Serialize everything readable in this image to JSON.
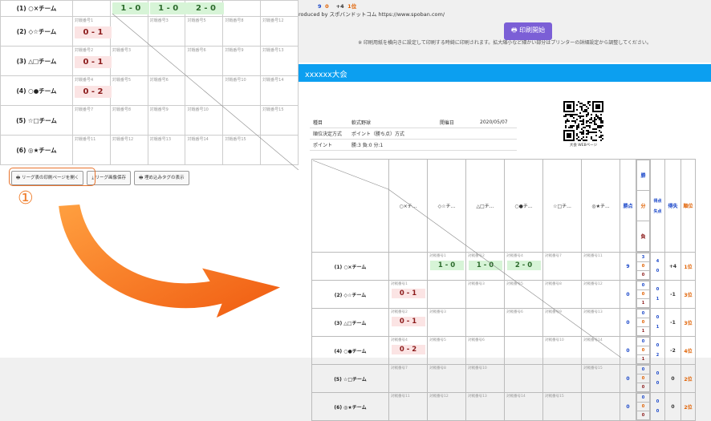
{
  "left": {
    "teams": [
      "(1) ○×チーム",
      "(2) ◇☆チーム",
      "(3) △□チーム",
      "(4) ○●チーム",
      "(5) ☆□チーム",
      "(6) ◎★チーム"
    ],
    "top_scores": [
      "1 - 0",
      "1 - 0",
      "2 - 0"
    ],
    "rows": [
      [
        {
          "n": "対戦番号1",
          "s": "0 - 1",
          "c": "r"
        },
        {
          "n": ""
        },
        {
          "n": "対戦番号3"
        },
        {
          "n": "対戦番号5"
        },
        {
          "n": "対戦番号8"
        },
        {
          "n": "対戦番号12"
        }
      ],
      [
        {
          "n": "対戦番号2",
          "s": "0 - 1",
          "c": "r"
        },
        {
          "n": "対戦番号3"
        },
        {
          "n": ""
        },
        {
          "n": "対戦番号6"
        },
        {
          "n": "対戦番号9"
        },
        {
          "n": "対戦番号13"
        }
      ],
      [
        {
          "n": "対戦番号4",
          "s": "0 - 2",
          "c": "r"
        },
        {
          "n": "対戦番号5"
        },
        {
          "n": "対戦番号6"
        },
        {
          "n": ""
        },
        {
          "n": "対戦番号10"
        },
        {
          "n": "対戦番号14"
        }
      ],
      [
        {
          "n": "対戦番号7"
        },
        {
          "n": "対戦番号8"
        },
        {
          "n": "対戦番号9"
        },
        {
          "n": "対戦番号10"
        },
        {
          "n": ""
        },
        {
          "n": "対戦番号15"
        }
      ],
      [
        {
          "n": "対戦番号11"
        },
        {
          "n": "対戦番号12"
        },
        {
          "n": "対戦番号13"
        },
        {
          "n": "対戦番号14"
        },
        {
          "n": "対戦番号15"
        },
        {
          "n": ""
        }
      ]
    ],
    "buttons": [
      "リーグ表の印刷ページを開く",
      "リーグ画像保存",
      "埋め込みタグの表示"
    ],
    "callout": "①"
  },
  "right": {
    "produced": "roduced by スポバンドットコム https://www.spoban.com/",
    "top_partial": [
      "9",
      "0",
      "+4",
      "1位"
    ],
    "print_button": "印刷開始",
    "note": "※ 印刷用紙を横向きに設定して印刷する時綺に印刷されます。拡大縮小など細かい部分はプリンターの詳細設定から調整してください。",
    "tournament": "xxxxxx大会",
    "info": [
      [
        "種目",
        "軟式野球",
        "開催日",
        "2020/05/07"
      ],
      [
        "順位決定方式",
        "ポイント（勝ち点）方式",
        "",
        ""
      ],
      [
        "ポイント",
        "勝:3 負:0 分:1",
        "",
        ""
      ]
    ],
    "qr_label": "大会 WEBページ",
    "headers": [
      "○×チ...",
      "◇☆チ...",
      "△□チ...",
      "○●チ...",
      "☆□チ...",
      "◎★チ..."
    ],
    "h_points": "勝点",
    "h_win": "勝",
    "h_draw": "分",
    "h_loss": "負",
    "h_gf": "得点",
    "h_ga": "失点",
    "h_diff": "得失",
    "h_rank": "順位",
    "teams": [
      "(1) ○×チーム",
      "(2) ◇☆チーム",
      "(3) △□チーム",
      "(4) ○●チーム",
      "(5) ☆□チーム",
      "(6) ◎★チーム"
    ],
    "grid": [
      [
        {
          "n": ""
        },
        {
          "n": "対戦番号1",
          "s": "1 - 0",
          "c": "g"
        },
        {
          "n": "対戦番号2",
          "s": "1 - 0",
          "c": "g"
        },
        {
          "n": "対戦番号4",
          "s": "2 - 0",
          "c": "g"
        },
        {
          "n": "対戦番号7"
        },
        {
          "n": "対戦番号11"
        }
      ],
      [
        {
          "n": "対戦番号1",
          "s": "0 - 1",
          "c": "r"
        },
        {
          "n": ""
        },
        {
          "n": "対戦番号3"
        },
        {
          "n": "対戦番号5"
        },
        {
          "n": "対戦番号8"
        },
        {
          "n": "対戦番号12"
        }
      ],
      [
        {
          "n": "対戦番号2",
          "s": "0 - 1",
          "c": "r"
        },
        {
          "n": "対戦番号3"
        },
        {
          "n": ""
        },
        {
          "n": "対戦番号6"
        },
        {
          "n": "対戦番号9"
        },
        {
          "n": "対戦番号13"
        }
      ],
      [
        {
          "n": "対戦番号4",
          "s": "0 - 2",
          "c": "r"
        },
        {
          "n": "対戦番号5"
        },
        {
          "n": "対戦番号6"
        },
        {
          "n": ""
        },
        {
          "n": "対戦番号10"
        },
        {
          "n": "対戦番号14"
        }
      ],
      [
        {
          "n": "対戦番号7"
        },
        {
          "n": "対戦番号8"
        },
        {
          "n": "対戦番号10"
        },
        {
          "n": ""
        },
        {
          "n": ""
        },
        {
          "n": "対戦番号15"
        }
      ],
      [
        {
          "n": "対戦番号11"
        },
        {
          "n": "対戦番号12"
        },
        {
          "n": "対戦番号13"
        },
        {
          "n": "対戦番号14"
        },
        {
          "n": "対戦番号15"
        },
        {
          "n": ""
        }
      ]
    ],
    "stats": [
      {
        "pts": "9",
        "w": "3",
        "d": "0",
        "l": "0",
        "gf": "4",
        "ga": "0",
        "diff": "+4",
        "rank": "1位"
      },
      {
        "pts": "0",
        "w": "0",
        "d": "0",
        "l": "1",
        "gf": "0",
        "ga": "1",
        "diff": "-1",
        "rank": "3位"
      },
      {
        "pts": "0",
        "w": "0",
        "d": "0",
        "l": "1",
        "gf": "0",
        "ga": "1",
        "diff": "-1",
        "rank": "3位"
      },
      {
        "pts": "0",
        "w": "0",
        "d": "0",
        "l": "1",
        "gf": "0",
        "ga": "2",
        "diff": "-2",
        "rank": "4位"
      },
      {
        "pts": "0",
        "w": "0",
        "d": "0",
        "l": "0",
        "gf": "0",
        "ga": "0",
        "diff": "0",
        "rank": "2位"
      },
      {
        "pts": "0",
        "w": "0",
        "d": "0",
        "l": "0",
        "gf": "0",
        "ga": "0",
        "diff": "0",
        "rank": "2位"
      }
    ]
  },
  "colors": {
    "accent": "#0c9ff0",
    "print": "#7b5fd6",
    "callout": "#f08030",
    "win": "#d7f4d7",
    "loss": "#fbe4e4"
  }
}
